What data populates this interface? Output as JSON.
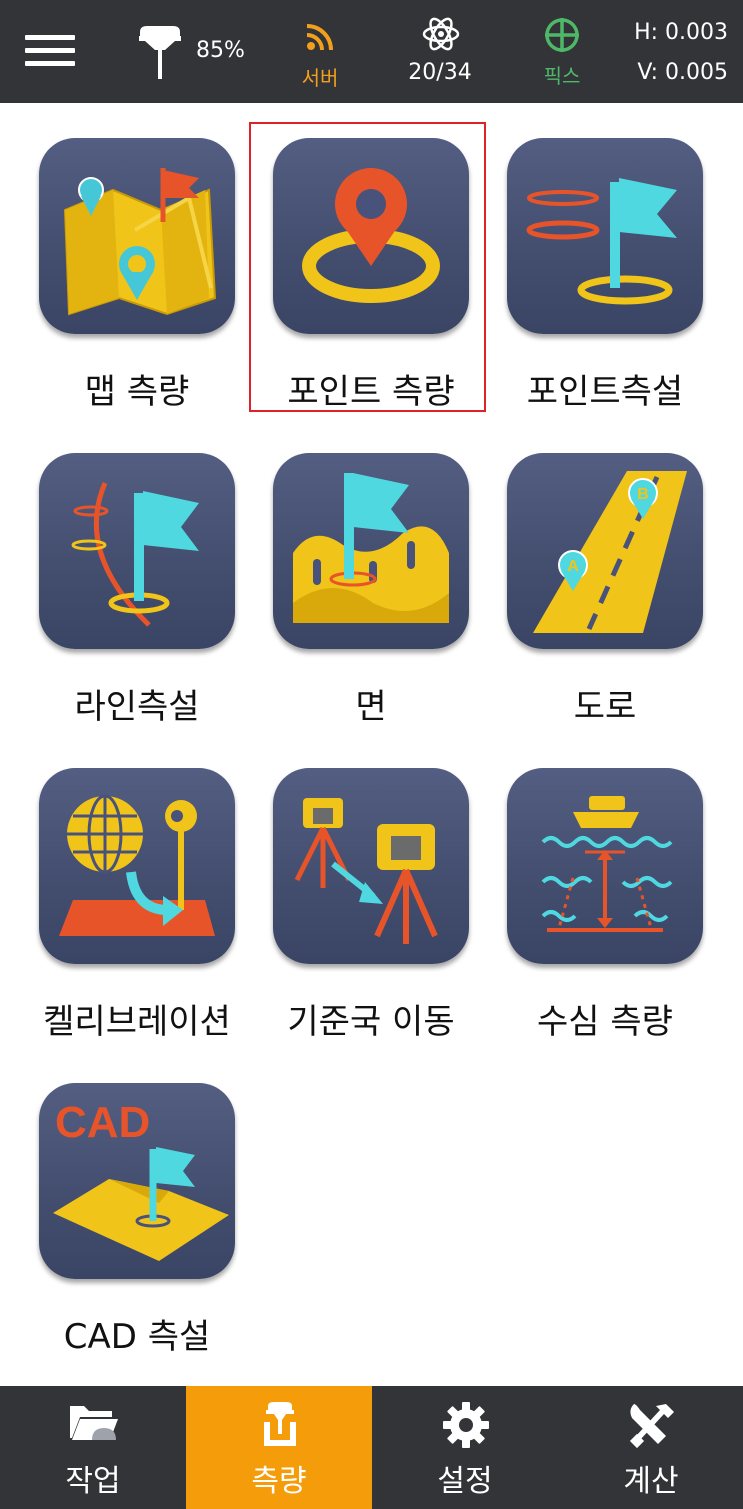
{
  "status_bar": {
    "battery_percent": "85%",
    "server_label": "서버",
    "satellites": "20/34",
    "fix_label": "픽스",
    "h_precision": "H: 0.003",
    "v_precision": "V: 0.005",
    "icons": [
      "menu-icon",
      "gnss-receiver-icon",
      "server-signal-icon",
      "satellite-atom-icon",
      "crosshair-fix-icon"
    ],
    "colors": {
      "server": "#f2a01c",
      "fix": "#4fb868"
    }
  },
  "tiles": [
    {
      "label": "맵 측량",
      "icon": "map-survey-icon"
    },
    {
      "label": "포인트 측량",
      "icon": "point-survey-icon",
      "selected": true
    },
    {
      "label": "포인트측설",
      "icon": "point-stakeout-icon"
    },
    {
      "label": "라인측설",
      "icon": "line-stakeout-icon"
    },
    {
      "label": "면",
      "icon": "surface-icon"
    },
    {
      "label": "도로",
      "icon": "road-icon"
    },
    {
      "label": "켈리브레이션",
      "icon": "calibration-icon"
    },
    {
      "label": "기준국 이동",
      "icon": "base-station-move-icon"
    },
    {
      "label": "수심 측량",
      "icon": "depth-survey-icon"
    },
    {
      "label": "CAD 측설",
      "icon": "cad-stakeout-icon",
      "icon_text": "CAD"
    }
  ],
  "bottom_nav": [
    {
      "label": "작업",
      "icon": "folder-job-icon"
    },
    {
      "label": "측량",
      "icon": "survey-receiver-icon",
      "active": true
    },
    {
      "label": "설정",
      "icon": "gear-icon"
    },
    {
      "label": "계산",
      "icon": "tools-calc-icon"
    }
  ],
  "colors": {
    "accent": "#f59c0a",
    "selection": "#e0212a",
    "bar_bg": "#323437",
    "tile_bg": "#48527a"
  }
}
